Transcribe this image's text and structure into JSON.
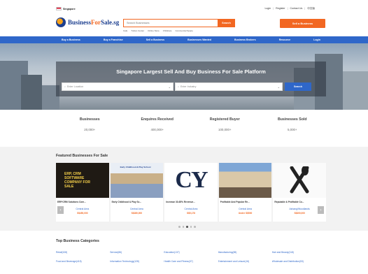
{
  "topbar": {
    "country": "Singapore",
    "links": [
      "Login",
      "Register",
      "Contact Us",
      "中文版"
    ]
  },
  "header": {
    "logo_text_1": "Business",
    "logo_text_2": "For",
    "logo_text_3": "Sale.sg",
    "search_placeholder": "Search Businesses",
    "search_button": "Search",
    "quick_links": [
      "Cafe",
      "Tuition Center",
      "Online Store",
      "Childcare",
      "Commercial Space"
    ],
    "sell_button": "Sell a Business"
  },
  "nav": {
    "items": [
      "Buy a Business",
      "Buy a Franchise",
      "Sell a Business",
      "Businesses Wanted",
      "Business Brokers",
      "Resource",
      "Login"
    ]
  },
  "hero": {
    "title": "Singapore Largest Sell And Buy Business For Sale Platform",
    "location_placeholder": "Enter Location",
    "industry_placeholder": "Enter Industry",
    "search_button": "Search"
  },
  "stats": [
    {
      "label": "Businesses",
      "value": "20,000+"
    },
    {
      "label": "Enquires Received",
      "value": "400,000+"
    },
    {
      "label": "Registered Buyer",
      "value": "100,000+"
    },
    {
      "label": "Businesses Sold",
      "value": "5,000+"
    }
  ],
  "featured": {
    "title": "Featured Businesses For Sale",
    "cards": [
      {
        "title": "ERP/CRM Solutions Com...",
        "area": "Central Area",
        "price": "S$450,000",
        "thumb_text": "ERP, CRM SOFTWARE COMPANY FOR SALE"
      },
      {
        "title": "Early Childhood & Play Sc...",
        "area": "Central Area",
        "price": "S$280,000",
        "thumb_text": "Early Childhood & Play School"
      },
      {
        "title": "Increase 30-65% Revenue...",
        "area": "Central Area",
        "price": "S$5,178",
        "thumb_text": "CY"
      },
      {
        "title": "Profitable And Popular Re...",
        "area": "Central Area",
        "price": "Under S$500",
        "thumb_text": ""
      },
      {
        "title": "Reputable & Profitable Co...",
        "area": "Ashang/Woodlands",
        "price": "S$300,000",
        "thumb_text": ""
      }
    ],
    "pager_count": 5,
    "pager_active": 2
  },
  "categories": {
    "title": "Top Business Categories",
    "items": [
      "Retail(108)",
      "Service(86)",
      "Education(137)",
      "Manufacturing(65)",
      "Hair and Beauty(118)",
      "Food and Beverage(415)",
      "Information Technology(128)",
      "Health Care and Fitness(37)",
      "Entertainment and Leisure(16)",
      "Wholesale and Distribution(53)"
    ]
  },
  "colors": {
    "accent": "#f26722",
    "brand_blue": "#2f67c9",
    "dark_blue": "#1d3f8f"
  }
}
